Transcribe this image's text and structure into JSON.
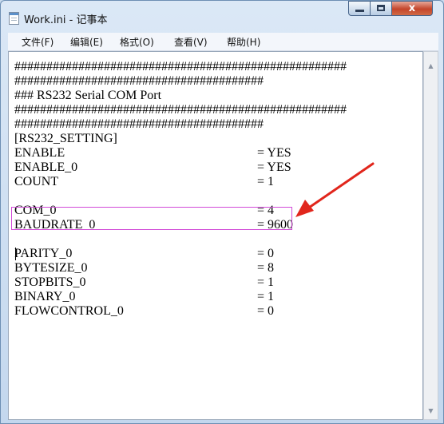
{
  "window": {
    "title": "Work.ini - 记事本",
    "buttons": {
      "minimize": "minimize",
      "maximize": "maximize",
      "close": "close"
    }
  },
  "menu": [
    "文件(F)",
    "编辑(E)",
    "格式(O)",
    "查看(V)",
    "帮助(H)"
  ],
  "file_lines": [
    "####################################################",
    "#######################################",
    "### RS232 Serial COM Port",
    "####################################################",
    "#######################################",
    "[RS232_SETTING]",
    {
      "key": "ENABLE",
      "value": "= YES"
    },
    {
      "key": "ENABLE_0",
      "value": "= YES"
    },
    {
      "key": "COUNT",
      "value": "= 1"
    },
    "",
    {
      "key": "COM_0",
      "value": "= 4"
    },
    {
      "key": "BAUDRATE_0",
      "value": "= 9600"
    },
    "",
    {
      "key": "PARITY_0",
      "value": "= 0"
    },
    {
      "key": "BYTESIZE_0",
      "value": "= 8"
    },
    {
      "key": "STOPBITS_0",
      "value": "= 1"
    },
    {
      "key": "BINARY_0",
      "value": "= 1"
    },
    {
      "key": "FLOWCONTROL_0",
      "value": "= 0"
    }
  ],
  "annotation": {
    "highlighted_key": "COM_0",
    "highlight_color": "#d14ad7",
    "arrow_color": "#e1261c"
  },
  "icons": {
    "app": "notepad-icon",
    "scroll_up": "scroll-up-arrow-icon",
    "scroll_down": "scroll-down-arrow-icon"
  }
}
